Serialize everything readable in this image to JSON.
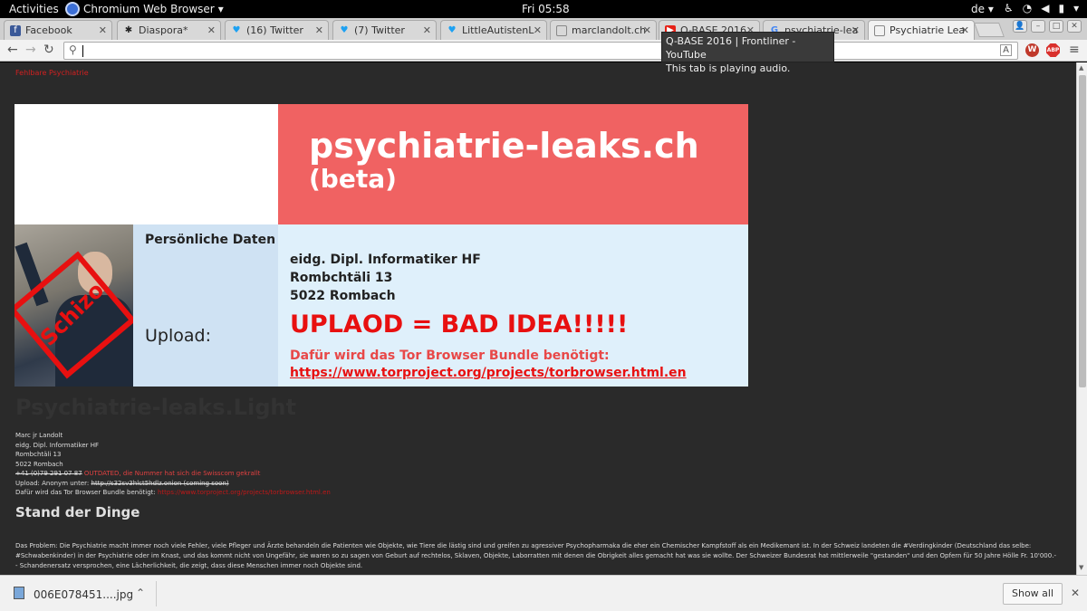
{
  "topbar": {
    "activities": "Activities",
    "app_name": "Chromium Web Browser",
    "clock": "Fri 05:58",
    "language": "de"
  },
  "tabs": [
    {
      "title": "Facebook",
      "icon": "facebook-icon"
    },
    {
      "title": "Diaspora*",
      "icon": "diaspora-icon"
    },
    {
      "title": "(16) Twitter",
      "icon": "twitter-icon"
    },
    {
      "title": "(7) Twitter",
      "icon": "twitter-icon"
    },
    {
      "title": "LittleAutistenL",
      "icon": "twitter-icon"
    },
    {
      "title": "marclandolt.ch",
      "icon": "page-icon"
    },
    {
      "title": "Q-BASE 2016",
      "icon": "youtube-icon"
    },
    {
      "title": "psychiatrie-lea",
      "icon": "google-icon"
    },
    {
      "title": "Psychiatrie Lea",
      "icon": "page-icon"
    }
  ],
  "tooltip": {
    "line1": "Q-BASE 2016 | Frontliner - YouTube",
    "line2": "This tab is playing audio."
  },
  "colors": {
    "banner_red": "#f06262",
    "page_bg": "#2a2a2a",
    "link_red": "#d12020"
  },
  "page": {
    "site_link": "Fehlbare Psychiatrie",
    "banner": {
      "title": "psychiatrie-leaks.ch",
      "subtitle": "(beta)",
      "personal_data_label": "Persönliche Daten",
      "address_line1": "eidg. Dipl. Informatiker HF",
      "address_line2": "Rombchtäli 13",
      "address_line3": "5022 Rombach",
      "upload_label": "Upload:",
      "bad_idea": "UPLAOD = BAD IDEA!!!!!",
      "tor_needed": "Dafür wird das Tor Browser Bundle benötigt:",
      "tor_link": "https://www.torproject.org/projects/torbrowser.html.en",
      "stamp_text": "Schizo"
    },
    "big_title": "Psychiatrie-leaks.Light",
    "info": {
      "name": "Marc jr Landolt",
      "title": "eidg. Dipl. Informatiker HF",
      "street": "Rombchtäli 13",
      "city": "5022 Rombach",
      "phone": "+41 (0)79 291 07 87",
      "phone_note": "OUTDATED, die Nummer hat sich die Swisscom gekrallt",
      "upload_label": "Upload: Anonym unter: ",
      "onion": "http://s32sv3hlct5hdlz.onion (coming soon)",
      "tor_label": "Dafür wird das Tor Browser Bundle benötigt: ",
      "tor_link": "https://www.torproject.org/projects/torbrowser.html.en"
    },
    "section_heading": "Stand der Dinge",
    "paragraph": "Das Problem: Die Psychiatrie macht immer noch viele Fehler, viele Pfleger und Ärzte behandeln die Patienten wie Objekte, wie Tiere die lästig sind und greifen zu agressiver Psychopharmaka die eher ein Chemischer Kampfstoff als ein Medikemant ist. In der Schweiz landeten die #Verdingkinder (Deutschland das selbe: #Schwabenkinder) in der Psychiatrie oder im Knast, und das kommt nicht von Ungefähr, sie waren so zu sagen von Geburt auf rechtelos, Sklaven, Objekte, Laborratten mit denen die Obrigkeit alles gemacht hat was sie wollte. Der Schweizer Bundesrat hat mittlerweile \"gestanden\" und den Opfern für 50 Jahre Hölle Fr. 10'000.-- Schandenersatz versprochen, eine Lächerlichkeit, die zeigt, dass diese Menschen immer noch Objekte sind."
  },
  "download": {
    "filename": "006E078451....jpg",
    "show_all": "Show all"
  }
}
